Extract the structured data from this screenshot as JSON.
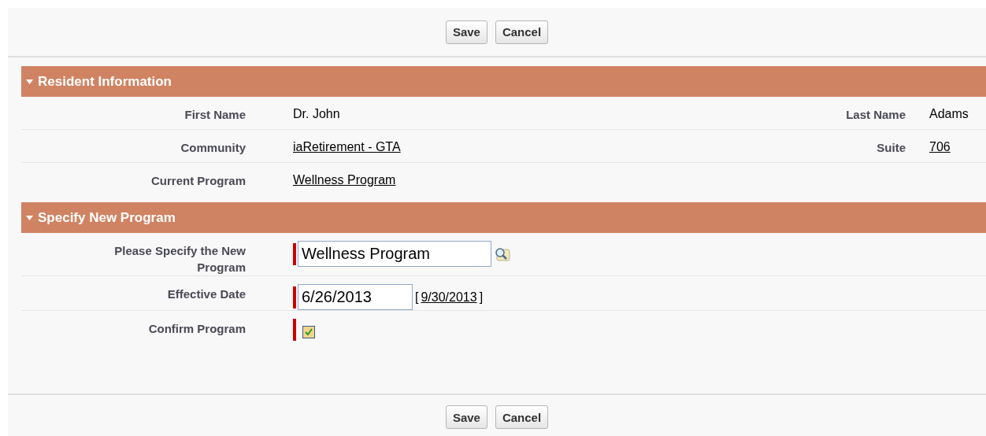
{
  "top_buttons": [
    "Save",
    "Cancel"
  ],
  "sections": [
    {
      "title": "Resident Information",
      "expanded": true,
      "rows": [
        {
          "fields": [
            {
              "label": "First Name",
              "kind": "text",
              "value": "Dr. John",
              "required": false
            },
            {
              "label": "Last Name",
              "kind": "text",
              "value": "Adams",
              "required": false
            }
          ]
        },
        {
          "fields": [
            {
              "label": "Community",
              "kind": "link",
              "value": "iaRetirement - GTA",
              "required": false
            },
            {
              "label": "Suite",
              "kind": "link",
              "value": "706",
              "required": false
            }
          ]
        },
        {
          "fields": [
            {
              "label": "Current Program",
              "kind": "link",
              "value": "Wellness Program",
              "required": false
            }
          ]
        }
      ]
    },
    {
      "title": "Specify New Program",
      "expanded": true,
      "rows": [
        {
          "fields": [
            {
              "label": "Please Specify the New Program",
              "kind": "lookup",
              "value": "Wellness Program",
              "required": true
            }
          ]
        },
        {
          "fields": [
            {
              "label": "Effective Date",
              "kind": "date",
              "value": "6/26/2013",
              "required": true,
              "open_bracket": "[",
              "today_link": "9/30/2013",
              "close_bracket": "]"
            }
          ]
        },
        {
          "fields": [
            {
              "label": "Confirm Program",
              "kind": "checkbox",
              "checked": true,
              "required": true
            }
          ]
        }
      ]
    }
  ],
  "bottom_buttons": [
    "Save",
    "Cancel"
  ]
}
